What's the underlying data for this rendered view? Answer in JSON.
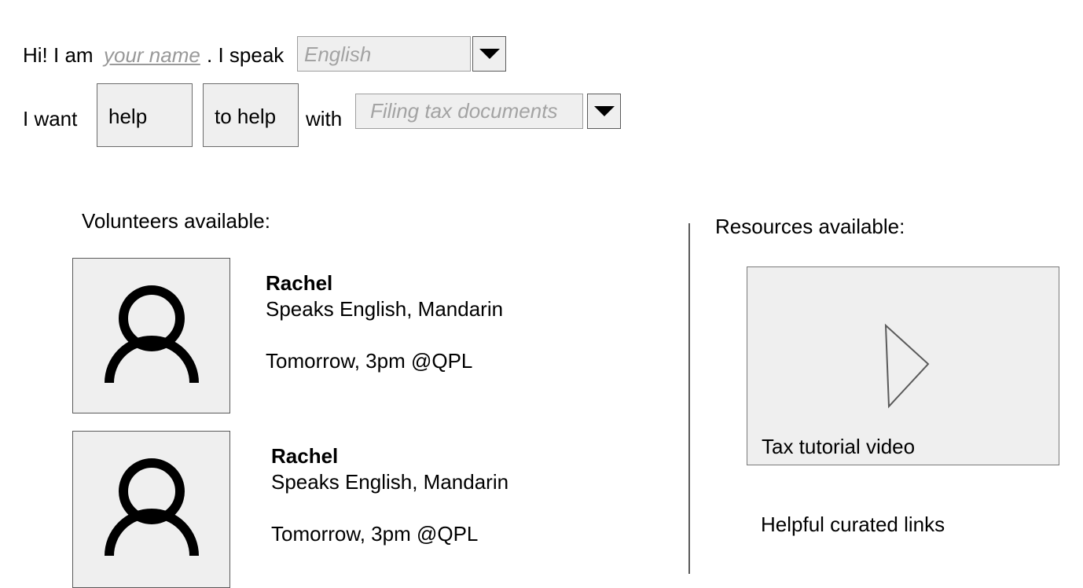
{
  "intro": {
    "greeting": "Hi! I am ",
    "name_placeholder": "your name",
    "speak_text": ". I speak",
    "language_value": "English"
  },
  "want": {
    "label": "I want",
    "help_button": "help",
    "to_help_button": "to help",
    "with_label": "with",
    "topic_value": "Filing tax documents"
  },
  "volunteers": {
    "heading": "Volunteers available:",
    "items": [
      {
        "name": "Rachel",
        "languages": "Speaks English, Mandarin",
        "availability": "Tomorrow, 3pm @QPL",
        "icon": "person-icon"
      },
      {
        "name": "Rachel",
        "languages": "Speaks English, Mandarin",
        "availability": "Tomorrow, 3pm @QPL",
        "icon": "person-icon"
      }
    ]
  },
  "resources": {
    "heading": "Resources available:",
    "video_label": "Tax tutorial video",
    "video_icon": "play-icon",
    "links_label": "Helpful curated links"
  }
}
